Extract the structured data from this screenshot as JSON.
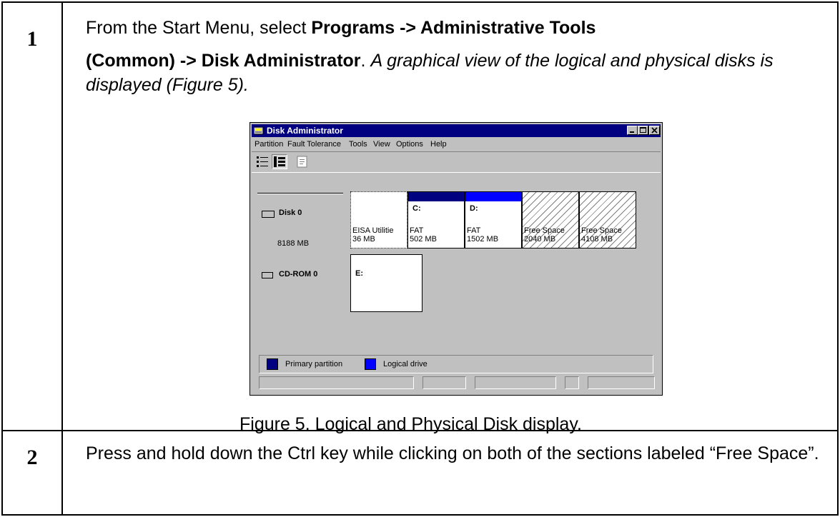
{
  "steps": [
    {
      "number": "1",
      "text_prefix": "From the Start Menu, select ",
      "bold_path_line1": "Programs -> Administrative Tools",
      "bold_path_line2": "(Common) -> Disk Administrator",
      "separator": ". ",
      "italic_text": "A graphical view of the logical and physical disks is displayed (Figure 5).",
      "caption": "Figure 5. Logical and Physical Disk display."
    },
    {
      "number": "2",
      "text": "Press and hold down the Ctrl key while clicking on both of the sections labeled “Free Space”."
    }
  ],
  "window": {
    "title": "Disk Administrator",
    "menu": [
      "Partition",
      "Fault Tolerance",
      "Tools",
      "View",
      "Options",
      "Help"
    ],
    "title_buttons": [
      "minimize-icon",
      "maximize-icon",
      "close-icon"
    ],
    "toolbar_icons": [
      "volumes-view-icon",
      "disk-view-icon",
      "properties-icon"
    ],
    "disks": [
      {
        "name": "Disk 0",
        "size": "8188 MB",
        "icon": "hard-disk-icon",
        "partitions": [
          {
            "letter": "",
            "fs": "EISA Utilitie",
            "size": "36 MB",
            "kind": "none"
          },
          {
            "letter": "C:",
            "fs": "FAT",
            "size": "502 MB",
            "kind": "primary"
          },
          {
            "letter": "D:",
            "fs": "FAT",
            "size": "1502 MB",
            "kind": "logical"
          },
          {
            "letter": "",
            "fs": "Free Space",
            "size": "2040 MB",
            "kind": "free"
          },
          {
            "letter": "",
            "fs": "Free Space",
            "size": "4108 MB",
            "kind": "free"
          }
        ]
      },
      {
        "name": "CD-ROM 0",
        "icon": "cdrom-icon",
        "partitions": [
          {
            "letter": "E:",
            "kind": "cdrom"
          }
        ]
      }
    ],
    "legend": [
      {
        "label": "Primary partition",
        "color": "#000080"
      },
      {
        "label": "Logical drive",
        "color": "#0000ff"
      }
    ]
  }
}
